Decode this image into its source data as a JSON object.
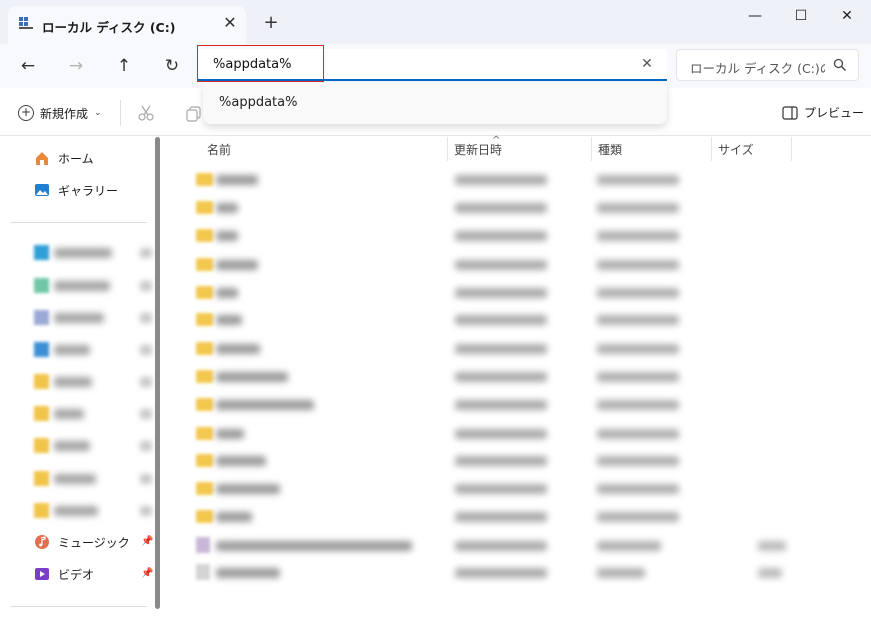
{
  "tab": {
    "title": "ローカル ディスク (C:)",
    "close_glyph": "✕",
    "new_tab_glyph": "+"
  },
  "window": {
    "minimize_glyph": "—",
    "maximize_glyph": "☐",
    "close_glyph": "✕"
  },
  "nav": {
    "back_glyph": "←",
    "forward_glyph": "→",
    "up_glyph": "↑",
    "refresh_glyph": "↻"
  },
  "address": {
    "value": "%appdata%",
    "clear_glyph": "✕"
  },
  "search": {
    "placeholder": "ローカル ディスク (C:)の検索"
  },
  "suggestions": [
    "%appdata%"
  ],
  "toolbar": {
    "new_label": "新規作成",
    "preview_label": "プレビュー"
  },
  "sidebar": {
    "home_label": "ホーム",
    "gallery_label": "ギャラリー",
    "music_label": "ミュージック",
    "video_label": "ビデオ"
  },
  "columns": {
    "name": "名前",
    "date": "更新日時",
    "type": "種類",
    "size": "サイズ"
  },
  "icons": {
    "tab": "drive-icon",
    "home": "home-icon",
    "gallery": "gallery-icon",
    "music": "music-icon",
    "video": "video-icon",
    "preview": "preview-pane-icon",
    "search": "search-icon",
    "cut": "cut-icon",
    "copy": "copy-icon"
  },
  "colors": {
    "accent": "#0067c0",
    "highlight_box": "#d8262d",
    "folder": "#f3c84e"
  }
}
